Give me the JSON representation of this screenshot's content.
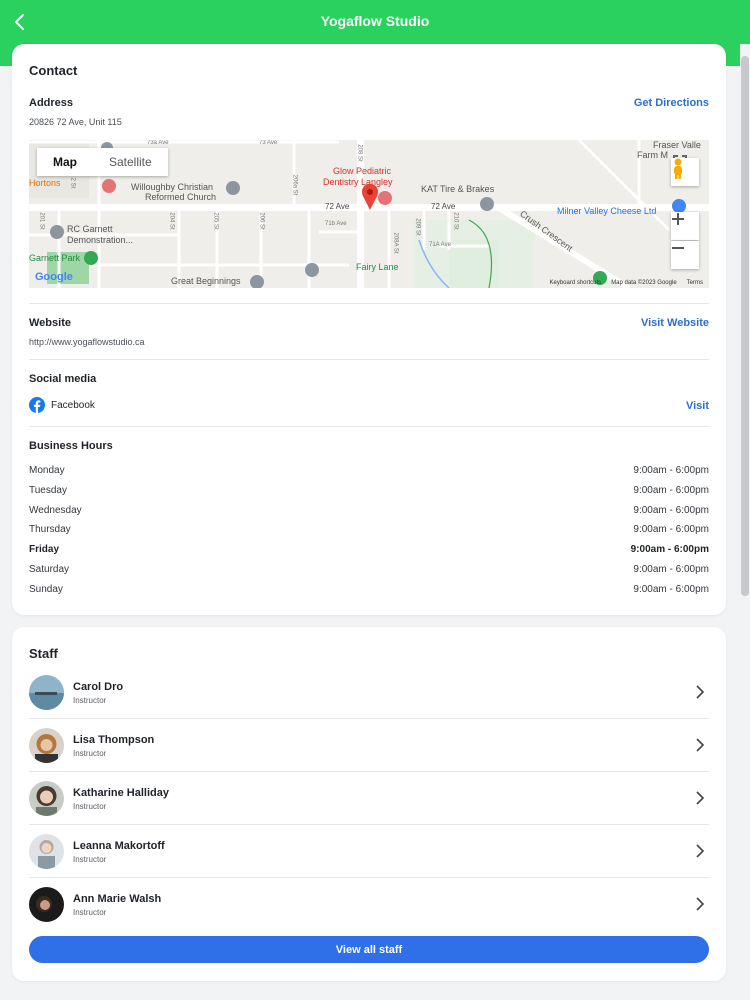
{
  "header": {
    "title": "Yogaflow Studio",
    "back_icon": "chevron-left-icon"
  },
  "colors": {
    "brand": "#2ad15f",
    "link": "#2b6fd1",
    "button": "#2f6fe8",
    "facebook": "#1877f2"
  },
  "contact": {
    "title": "Contact",
    "address": {
      "label": "Address",
      "value": "20826 72 Ave, Unit 115",
      "action": "Get Directions"
    },
    "map": {
      "toggle": {
        "map": "Map",
        "satellite": "Satellite",
        "selected": "Map"
      },
      "labels": {
        "glow": "Glow Pediatric",
        "glow2": "Dentistry Langley",
        "kat": "KAT Tire & Brakes",
        "church1": "Willoughby Christian",
        "church2": "Reformed Church",
        "milner": "Milner Valley Cheese Ltd",
        "rc1": "RC Garnett",
        "rc2": "Demonstration...",
        "garnett": "Garnett Park",
        "great": "Great Beginnings",
        "fairy": "Fairy Lane",
        "fraser1": "Fraser Valle",
        "fraser2": "Farm M",
        "hortons": "Hortons",
        "crush": "Crush Crescent",
        "ave72a": "72 Ave",
        "ave72b": "72 Ave",
        "ave73a": "73 Ave",
        "ave73a2": "73a Ave",
        "ave71b": "71b Ave",
        "ave71a": "71A Ave",
        "st208": "208 St",
        "st206a": "206a St",
        "st204": "204 St",
        "st205": "205 St",
        "st206": "206 St",
        "st201": "201 St",
        "st208a": "208A St",
        "st209": "209 St",
        "st210": "210 St",
        "st202": "2 St",
        "google": "Google",
        "keyboard": "Keyboard shortcuts",
        "mapdata": "Map data ©2023 Google",
        "terms": "Terms"
      }
    },
    "website": {
      "label": "Website",
      "value": "http://www.yogaflowstudio.ca",
      "action": "Visit Website"
    },
    "social": {
      "label": "Social media",
      "network": "Facebook",
      "action": "Visit"
    },
    "hours": {
      "label": "Business Hours",
      "today": "Friday",
      "rows": [
        {
          "day": "Monday",
          "time": "9:00am - 6:00pm"
        },
        {
          "day": "Tuesday",
          "time": "9:00am - 6:00pm"
        },
        {
          "day": "Wednesday",
          "time": "9:00am - 6:00pm"
        },
        {
          "day": "Thursday",
          "time": "9:00am - 6:00pm"
        },
        {
          "day": "Friday",
          "time": "9:00am - 6:00pm"
        },
        {
          "day": "Saturday",
          "time": "9:00am - 6:00pm"
        },
        {
          "day": "Sunday",
          "time": "9:00am - 6:00pm"
        }
      ]
    }
  },
  "staff": {
    "title": "Staff",
    "members": [
      {
        "name": "Carol Dro",
        "role": "Instructor"
      },
      {
        "name": "Lisa Thompson",
        "role": "Instructor"
      },
      {
        "name": "Katharine Halliday",
        "role": "Instructor"
      },
      {
        "name": "Leanna Makortoff",
        "role": "Instructor"
      },
      {
        "name": "Ann Marie Walsh",
        "role": "Instructor"
      }
    ],
    "view_all": "View all staff"
  }
}
